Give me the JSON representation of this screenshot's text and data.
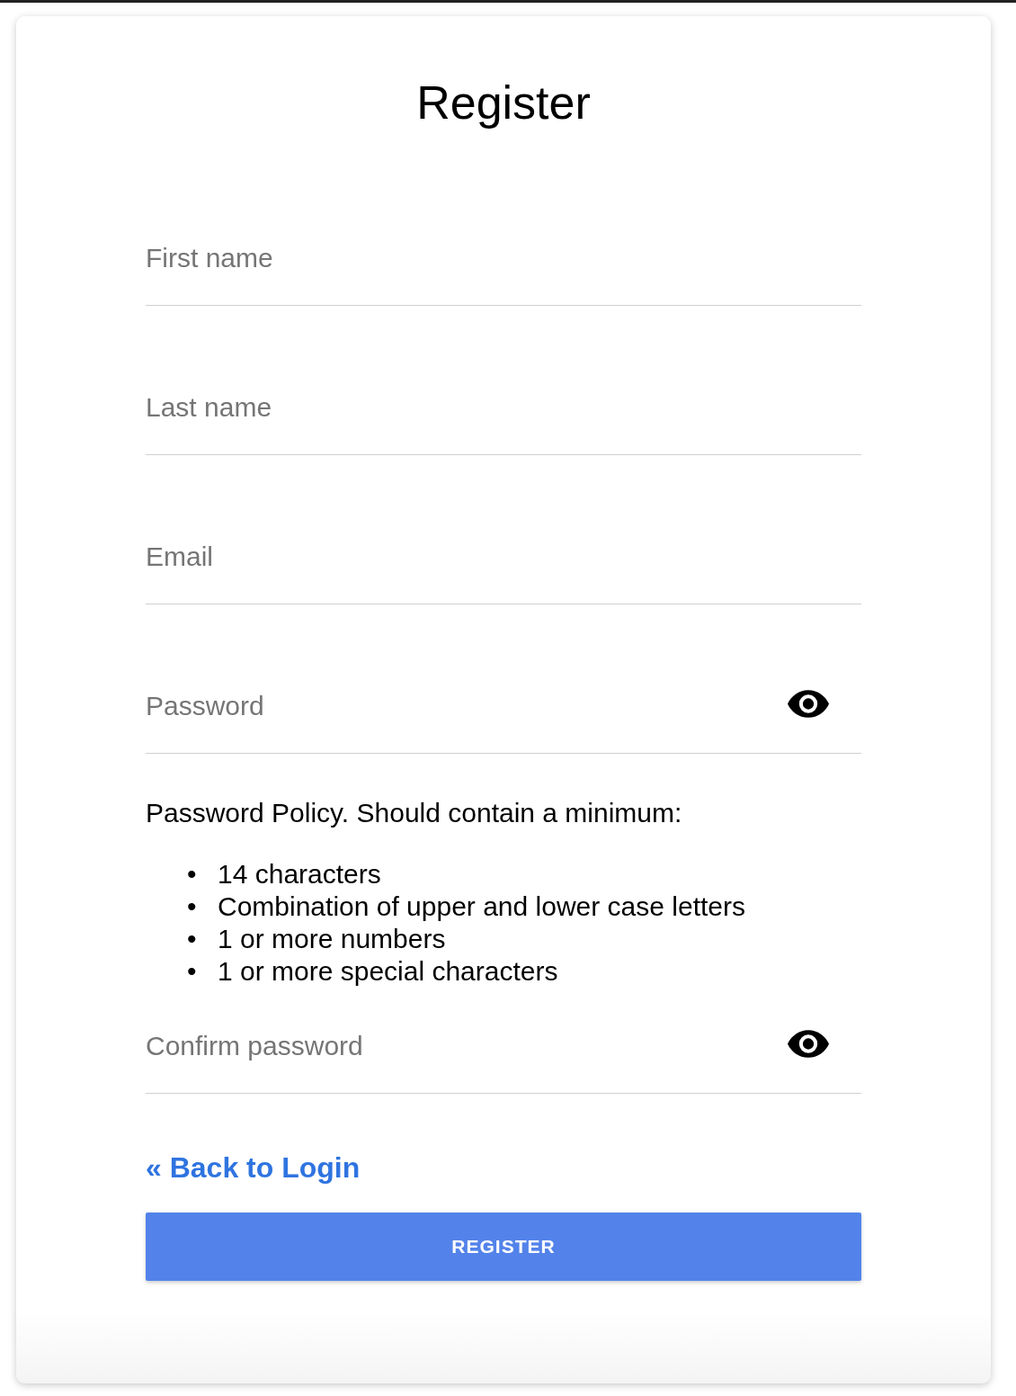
{
  "title": "Register",
  "fields": [
    {
      "kind": "text",
      "placeholder": "First name"
    },
    {
      "kind": "text",
      "placeholder": "Last name"
    },
    {
      "kind": "text",
      "placeholder": "Email"
    },
    {
      "kind": "password",
      "placeholder": "Password"
    }
  ],
  "policy": {
    "heading": "Password Policy. Should contain a minimum:",
    "items": [
      {
        "marker": "•",
        "text": "14 characters"
      },
      {
        "marker": "•",
        "text": "Combination of upper and lower case letters"
      },
      {
        "marker": "•",
        "text": "1 or more numbers"
      },
      {
        "marker": "•",
        "text": "1 or more special characters"
      }
    ]
  },
  "confirm_field": {
    "kind": "password",
    "placeholder": "Confirm password"
  },
  "back_link": "« Back to Login",
  "submit_button": "REGISTER"
}
